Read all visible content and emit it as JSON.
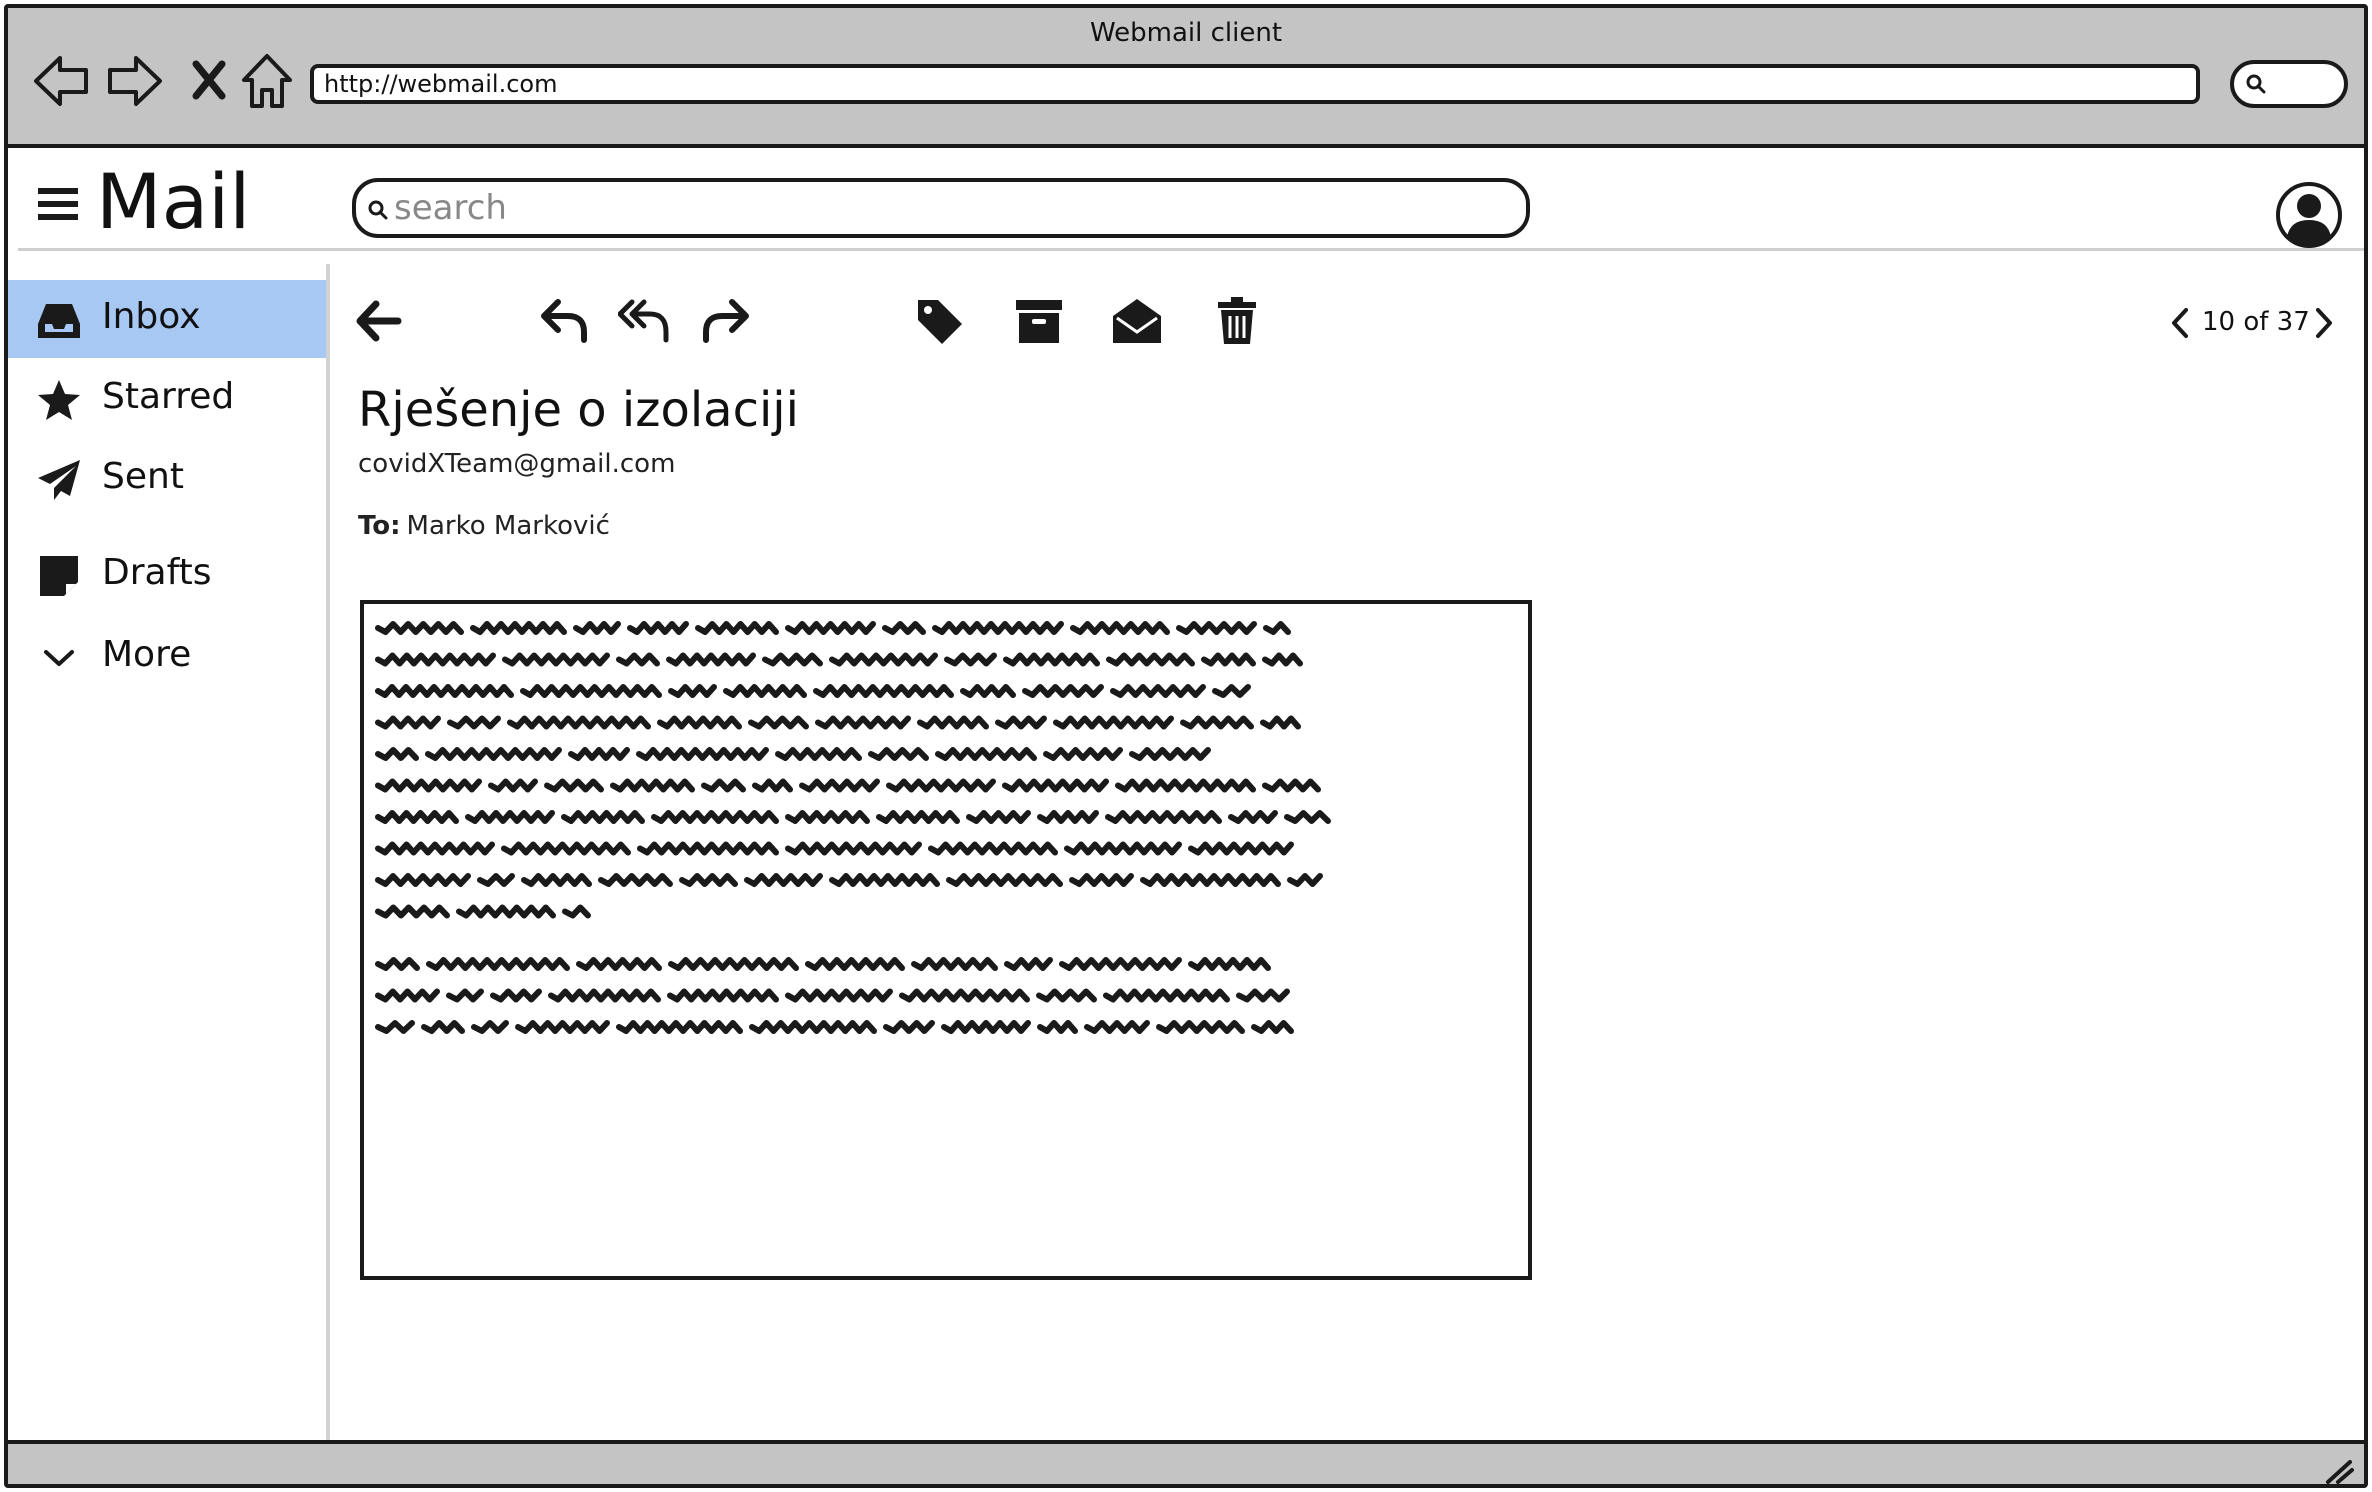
{
  "window": {
    "title": "Webmail client"
  },
  "browser": {
    "url": "http://webmail.com",
    "nav_icons": [
      "back-arrow-icon",
      "forward-arrow-icon",
      "stop-icon",
      "home-icon"
    ]
  },
  "app": {
    "name": "Mail",
    "search_placeholder": "search"
  },
  "sidebar": {
    "items": [
      {
        "label": "Inbox",
        "icon": "inbox-icon",
        "active": true
      },
      {
        "label": "Starred",
        "icon": "star-icon",
        "active": false
      },
      {
        "label": "Sent",
        "icon": "paper-plane-icon",
        "active": false
      },
      {
        "label": "Drafts",
        "icon": "sticky-note-icon",
        "active": false
      },
      {
        "label": "More",
        "icon": "chevron-down-icon",
        "active": false
      }
    ]
  },
  "toolbar": {
    "icons": [
      "back-icon",
      "reply-icon",
      "reply-all-icon",
      "forward-icon",
      "tag-icon",
      "archive-icon",
      "mark-read-icon",
      "trash-icon"
    ],
    "pager": "10 of 37"
  },
  "message": {
    "subject": "Rješenje o izolaciji",
    "sender": "covidXTeam@gmail.com",
    "to_label": "To:",
    "to_name": "Marko Marković"
  },
  "colors": {
    "chrome": "#c4c4c4",
    "active_item": "#a8c8f4",
    "stroke": "#1a1a1a"
  }
}
